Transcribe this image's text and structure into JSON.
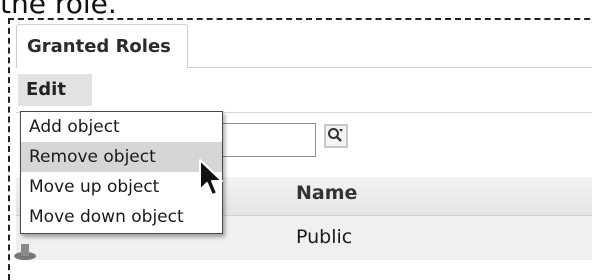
{
  "caption_fragment": "the role.",
  "tabs": [
    {
      "label": "Granted Roles",
      "active": true
    }
  ],
  "toolbar": {
    "edit_label": "Edit"
  },
  "edit_menu": {
    "items": [
      {
        "label": "Add object"
      },
      {
        "label": "Remove object",
        "hovered": true
      },
      {
        "label": "Move up object"
      },
      {
        "label": "Move down object"
      }
    ]
  },
  "search": {
    "value": "",
    "icon": "search-icon"
  },
  "table": {
    "columns": [
      "Name"
    ],
    "rows": [
      {
        "name": "Public",
        "icon": "role-icon"
      }
    ]
  },
  "colors": {
    "tab_bg": "#ffffff",
    "edit_bg": "#e2e2e2",
    "menu_hover": "#d6d6d6",
    "row_bg": "#f0f0f0"
  }
}
